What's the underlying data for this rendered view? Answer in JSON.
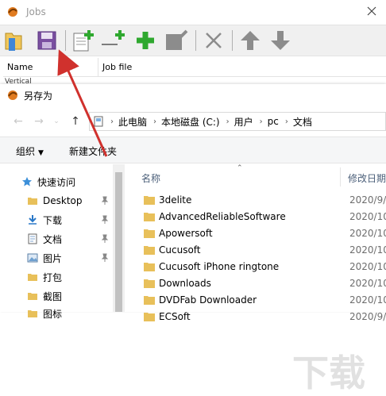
{
  "jobs_window": {
    "title": "Jobs",
    "columns": [
      "Name",
      "Job file"
    ],
    "row_peek": "Vertical"
  },
  "save_dialog": {
    "title": "另存为",
    "address": [
      "此电脑",
      "本地磁盘 (C:)",
      "用户",
      "pc",
      "文档"
    ],
    "commands": {
      "organize": "组织",
      "new_folder": "新建文件夹"
    },
    "nav_items": [
      {
        "label": "快速访问",
        "icon": "star-icon"
      },
      {
        "label": "Desktop",
        "icon": "folder-icon",
        "pinned": true
      },
      {
        "label": "下载",
        "icon": "download-icon",
        "pinned": true
      },
      {
        "label": "文档",
        "icon": "document-icon",
        "pinned": true
      },
      {
        "label": "图片",
        "icon": "picture-icon",
        "pinned": true
      },
      {
        "label": "打包",
        "icon": "folder-icon"
      },
      {
        "label": "截图",
        "icon": "folder-icon"
      },
      {
        "label": "图标",
        "icon": "folder-icon"
      }
    ],
    "columns": {
      "name": "名称",
      "modified": "修改日期"
    },
    "files": [
      {
        "name": "3delite",
        "date": "2020/9/2"
      },
      {
        "name": "AdvancedReliableSoftware",
        "date": "2020/10/"
      },
      {
        "name": "Apowersoft",
        "date": "2020/10/"
      },
      {
        "name": "Cucusoft",
        "date": "2020/10/"
      },
      {
        "name": "Cucusoft iPhone ringtone",
        "date": "2020/10/"
      },
      {
        "name": "Downloads",
        "date": "2020/10/"
      },
      {
        "name": "DVDFab Downloader",
        "date": "2020/10/"
      },
      {
        "name": "ECSoft",
        "date": "2020/9/"
      }
    ]
  },
  "colors": {
    "accent_arrow": "#d0312d",
    "folder": "#e8c05a",
    "toolbar_green": "#2fa82f",
    "toolbar_gray": "#8c8c8c"
  }
}
